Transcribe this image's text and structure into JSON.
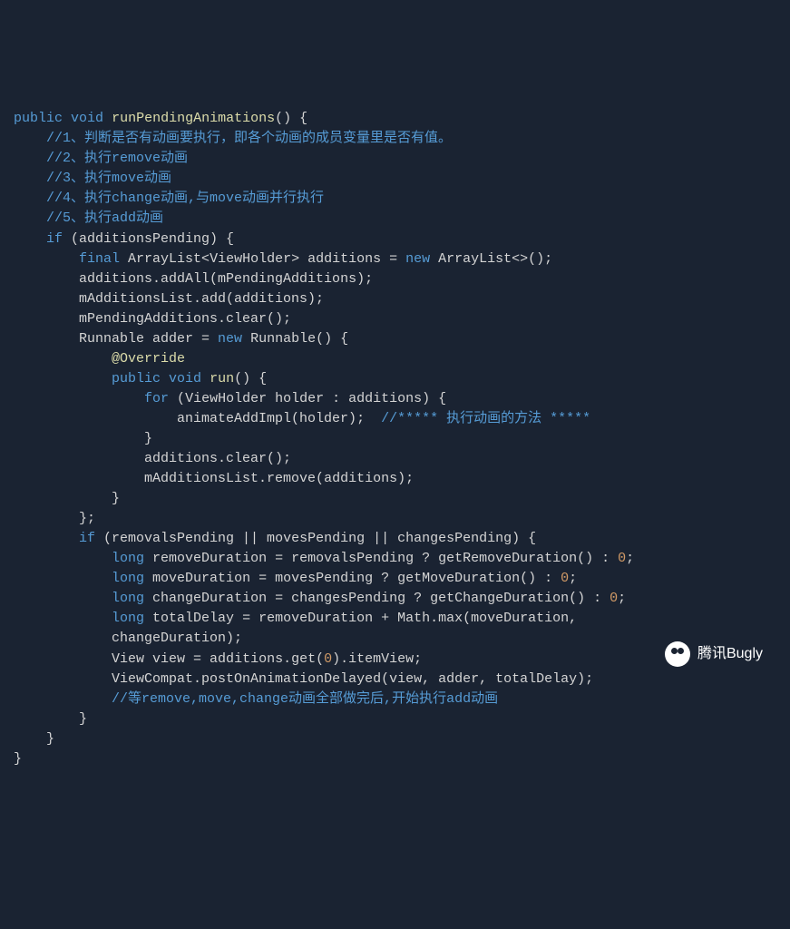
{
  "code": {
    "line1_public": "public",
    "line1_void": "void",
    "line1_method": "runPendingAnimations",
    "line1_rest": "() {",
    "comment1": "//1、判断是否有动画要执行，即各个动画的成员变量里是否有值。",
    "comment2": "//2、执行remove动画",
    "comment3": "//3、执行move动画",
    "comment4": "//4、执行change动画,与move动画并行执行",
    "comment5": "//5、执行add动画",
    "line7_if": "if",
    "line7_cond": " (additionsPending) {",
    "line8_final": "final",
    "line8_type1": " ArrayList",
    "line8_gen": "<",
    "line8_type2": "ViewHolder",
    "line8_gen2": "> additions = ",
    "line8_new": "new",
    "line8_type3": " ArrayList",
    "line8_rest": "<>();",
    "line9": "additions.addAll(mPendingAdditions);",
    "line10": "mAdditionsList.add(additions);",
    "line11": "mPendingAdditions.clear();",
    "line12_type": "Runnable",
    "line12_mid": " adder = ",
    "line12_new": "new",
    "line12_type2": " Runnable",
    "line12_rest": "() {",
    "line13_anno": "@Override",
    "line14_public": "public",
    "line14_void": " void",
    "line14_method": " run",
    "line14_rest": "() {",
    "line15_for": "for",
    "line15_mid": " (",
    "line15_type": "ViewHolder",
    "line15_rest": " holder : additions) {",
    "line16_method": "animateAddImpl(holder);  ",
    "line16_comment": "//***** 执行动画的方法 *****",
    "line17": "}",
    "line18": "additions.clear();",
    "line19": "mAdditionsList.remove(additions);",
    "line20": "}",
    "line21": "};",
    "line22_if": "if",
    "line22_rest": " (removalsPending || movesPending || changesPending) {",
    "line23_long": "long",
    "line23_mid": " removeDuration = removalsPending ? getRemoveDuration() : ",
    "line23_num": "0",
    "line23_end": ";",
    "line24_long": "long",
    "line24_mid": " moveDuration = movesPending ? getMoveDuration() : ",
    "line24_num": "0",
    "line24_end": ";",
    "line25_long": "long",
    "line25_mid": " changeDuration = changesPending ? getChangeDuration() : ",
    "line25_num": "0",
    "line25_end": ";",
    "line26_long": "long",
    "line26_rest": " totalDelay = removeDuration + Math.max(moveDuration,",
    "line27": "changeDuration);",
    "line28_type": "View",
    "line28_mid": " view = additions.get(",
    "line28_num": "0",
    "line28_rest": ").itemView;",
    "line29": "ViewCompat.postOnAnimationDelayed(view, adder, totalDelay);",
    "line30_comment": "//等remove,move,change动画全部做完后,开始执行add动画",
    "line31": "}",
    "line32": "}",
    "line33": "}"
  },
  "watermark": "腾讯Bugly"
}
